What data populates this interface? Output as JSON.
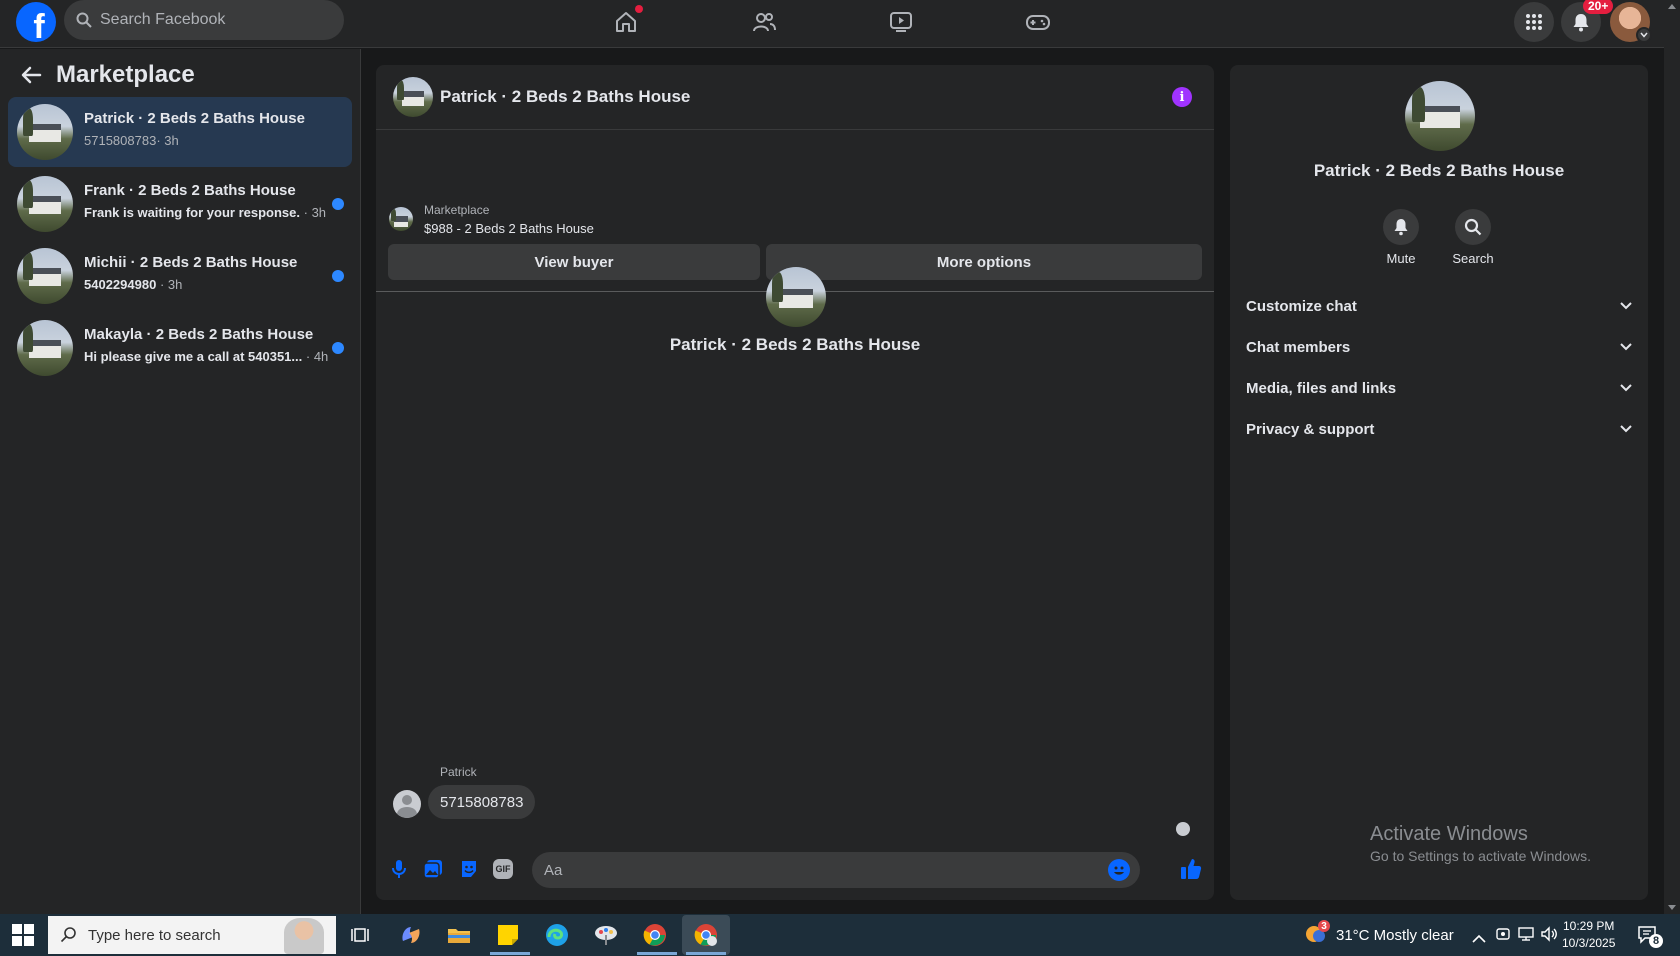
{
  "topbar": {
    "search_placeholder": "Search Facebook",
    "notification_count": "20+",
    "brand_color": "#0866ff"
  },
  "left_panel": {
    "title": "Marketplace",
    "conversations": [
      {
        "name": "Patrick · 2 Beds 2 Baths House",
        "preview": "5715808783",
        "time": "· 3h",
        "unread": false,
        "active": true
      },
      {
        "name": "Frank · 2 Beds 2 Baths House",
        "preview": "Frank is waiting for your response.",
        "time": "· 3h",
        "unread": true,
        "active": false
      },
      {
        "name": "Michii · 2 Beds 2 Baths House",
        "preview": "5402294980",
        "time": "· 3h",
        "unread": true,
        "active": false
      },
      {
        "name": "Makayla · 2 Beds 2 Baths House",
        "preview": "Hi please give me a call at 540351...",
        "time": "· 4h",
        "unread": true,
        "active": false
      }
    ]
  },
  "chat": {
    "title": "Patrick · 2 Beds 2 Baths House",
    "listing_source": "Marketplace",
    "listing_price": "$988 - 2 Beds 2 Baths House",
    "view_buyer_label": "View buyer",
    "more_options_label": "More options",
    "center_name": "Patrick · 2 Beds 2 Baths House",
    "sender_name": "Patrick",
    "message": "5715808783",
    "input_placeholder": "Aa",
    "gif_label": "GIF"
  },
  "details": {
    "name": "Patrick · 2 Beds 2 Baths House",
    "mute_label": "Mute",
    "search_label": "Search",
    "sections": [
      "Customize chat",
      "Chat members",
      "Media, files and links",
      "Privacy & support"
    ],
    "watermark_title": "Activate Windows",
    "watermark_sub": "Go to Settings to activate Windows."
  },
  "taskbar": {
    "search_placeholder": "Type here to search",
    "weather_badge": "3",
    "weather": "31°C  Mostly clear",
    "time": "10:29 PM",
    "date": "10/3/2025",
    "notifications": "8"
  }
}
